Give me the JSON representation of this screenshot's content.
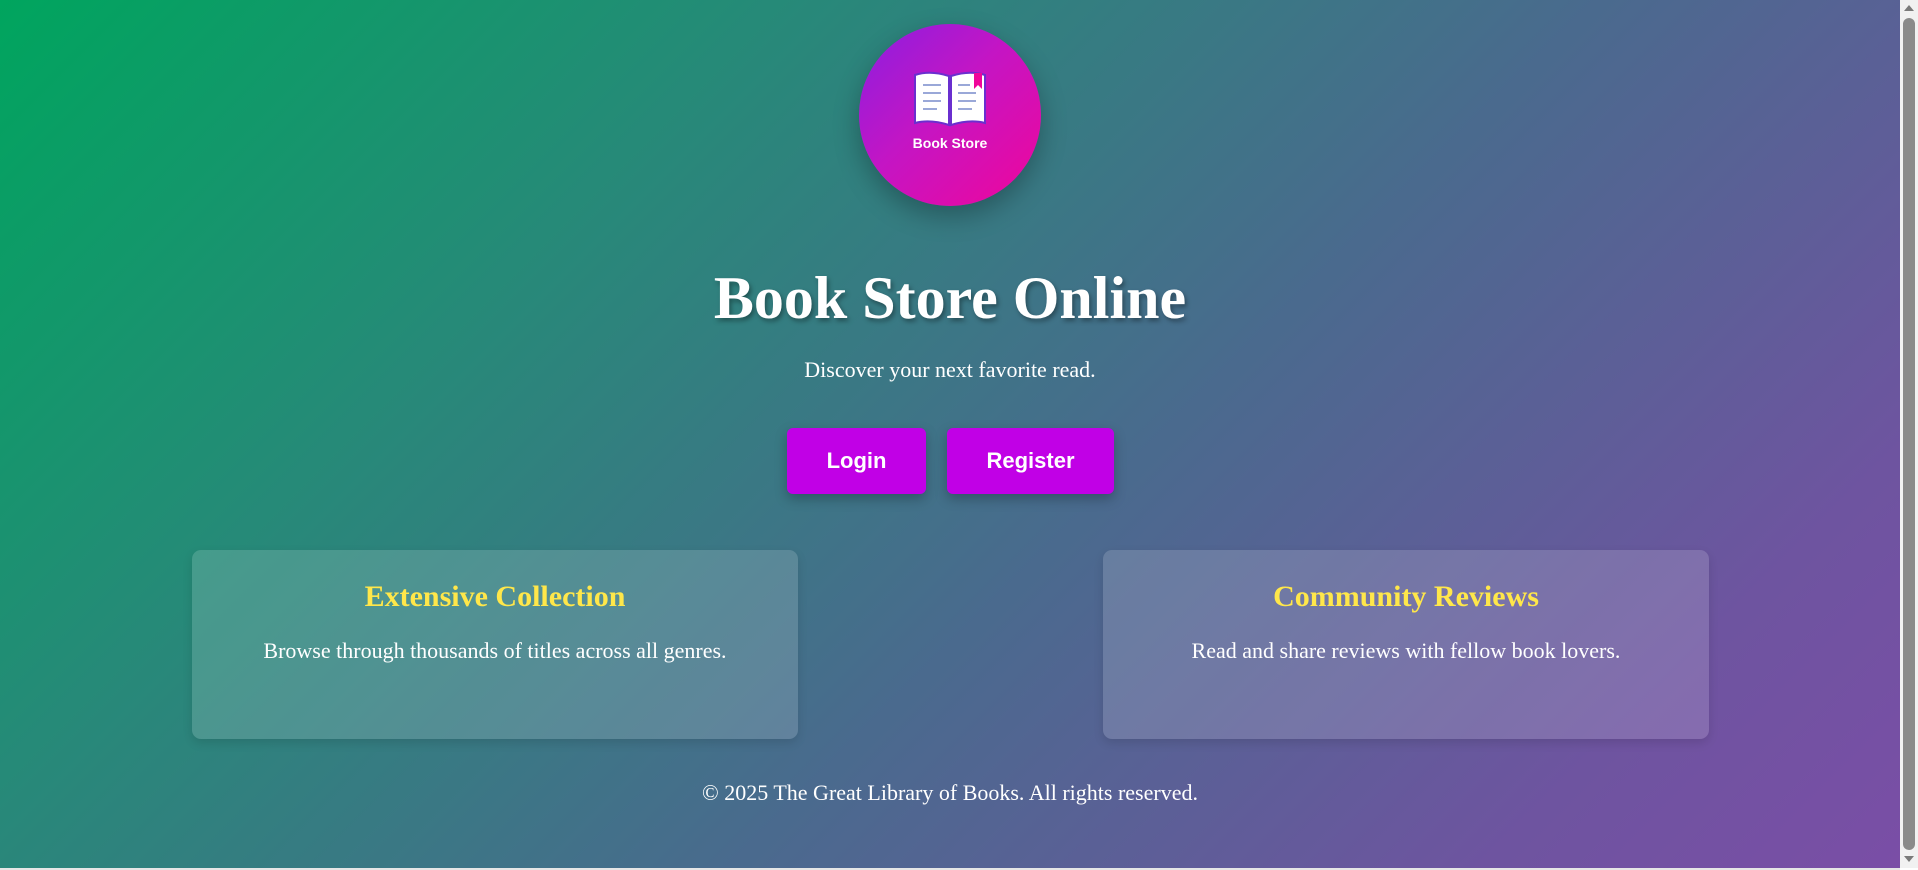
{
  "logo": {
    "text": "Book Store",
    "icon": "open-book-icon"
  },
  "hero": {
    "title": "Book Store Online",
    "subtitle": "Discover your next favorite read."
  },
  "actions": {
    "login_label": "Login",
    "register_label": "Register"
  },
  "features": [
    {
      "title": "Extensive Collection",
      "description": "Browse through thousands of titles across all genres."
    },
    {
      "title": "Community Reviews",
      "description": "Read and share reviews with fellow book lovers."
    }
  ],
  "footer": {
    "text": "© 2025 The Great Library of Books. All rights reserved."
  },
  "colors": {
    "button": "#c100e6",
    "feature_title": "#ffe74a",
    "logo_gradient_start": "#8a1fe0",
    "logo_gradient_end": "#f0069a",
    "background_start": "#00a55e",
    "background_end": "#7a4ea6"
  }
}
